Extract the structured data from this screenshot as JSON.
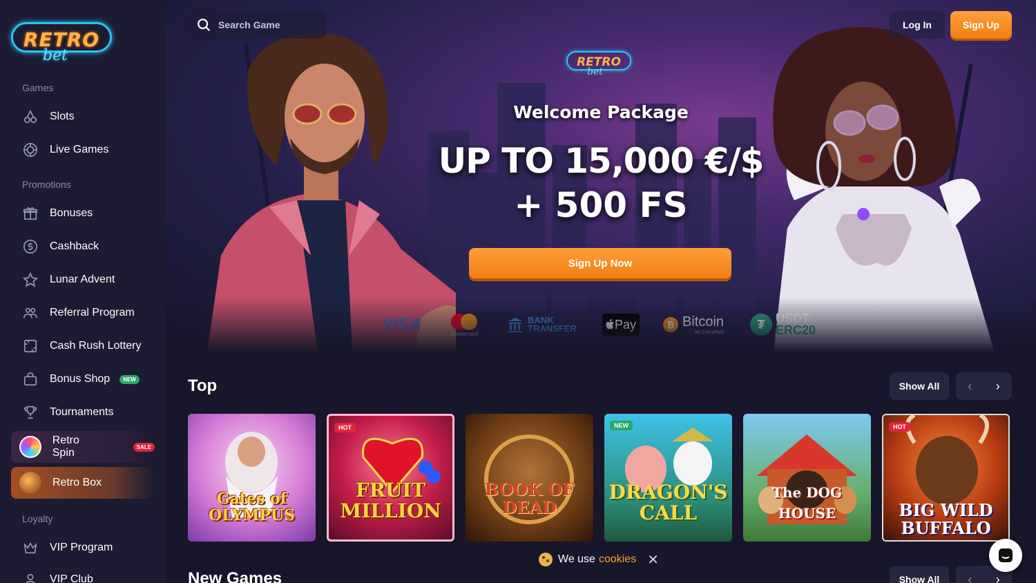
{
  "brand": {
    "word1": "RETRO",
    "word2": "bet"
  },
  "sidebar": {
    "sections": {
      "games": "Games",
      "promotions": "Promotions",
      "loyalty": "Loyalty"
    },
    "games": [
      {
        "label": "Slots",
        "icon": "cherries-icon"
      },
      {
        "label": "Live Games",
        "icon": "poker-chip-icon"
      }
    ],
    "promotions": [
      {
        "label": "Bonuses",
        "icon": "gift-icon"
      },
      {
        "label": "Cashback",
        "icon": "dollar-refresh-icon"
      },
      {
        "label": "Lunar Advent",
        "icon": "star-icon"
      },
      {
        "label": "Referral Program",
        "icon": "users-icon"
      },
      {
        "label": "Cash Rush Lottery",
        "icon": "ticket-icon"
      },
      {
        "label": "Bonus Shop",
        "icon": "bag-icon",
        "badge": "NEW"
      },
      {
        "label": "Tournaments",
        "icon": "trophy-icon"
      }
    ],
    "retro_spin": {
      "label": "Retro Spin",
      "badge": "SALE"
    },
    "retro_box": {
      "label": "Retro Box"
    },
    "loyalty": [
      {
        "label": "VIP Program",
        "icon": "crown-icon"
      },
      {
        "label": "VIP Club",
        "icon": "user-icon"
      }
    ]
  },
  "header": {
    "search_placeholder": "Search Game",
    "login": "Log In",
    "signup": "Sign Up"
  },
  "hero": {
    "welcome": "Welcome Package",
    "amount": "UP TO 15,000 €/$",
    "free_spins": "+ 500 FS",
    "cta": "Sign Up Now",
    "payments": {
      "visa": "VISA",
      "mastercard": "mastercard",
      "bank1": "BANK",
      "bank2": "TRANSFER",
      "applepay": "Pay",
      "bitcoin": "Bitcoin",
      "bitcoin_sub": "by CoinsPaid",
      "usdt": "USDT",
      "usdt_sub": "ERC20"
    }
  },
  "top": {
    "title": "Top",
    "show_all": "Show All",
    "games": [
      {
        "title": "Gates of OLYMPUS",
        "tag": ""
      },
      {
        "title": "FRUIT MILLION",
        "tag": "HOT"
      },
      {
        "title": "BOOK OF DEAD",
        "tag": ""
      },
      {
        "title": "DRAGON'S CALL",
        "tag": "NEW"
      },
      {
        "title": "The DOG HOUSE",
        "tag": ""
      },
      {
        "title": "BIG WILD BUFFALO",
        "tag": "HOT"
      }
    ]
  },
  "new_games": {
    "title": "New Games",
    "show_all": "Show All"
  },
  "cookie": {
    "text": "We use",
    "link": "cookies"
  },
  "colors": {
    "accent": "#f5861e",
    "bg": "#17162a",
    "sidebar": "#1c1b31",
    "cyan": "#29c6e8"
  }
}
